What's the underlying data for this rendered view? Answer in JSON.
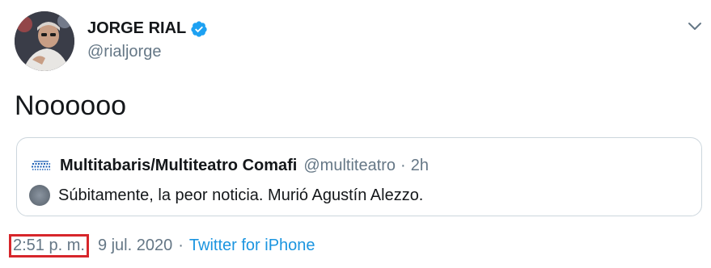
{
  "tweet": {
    "author": {
      "display_name": "JORGE RIAL",
      "handle": "@rialjorge",
      "verified": true
    },
    "text": "Noooooo",
    "quoted": {
      "name": "Multitabaris/Multiteatro Comafi",
      "handle": "@multiteatro",
      "separator": "·",
      "time": "2h",
      "text": "Súbitamente, la peor noticia. Murió Agustín Alezzo."
    },
    "meta": {
      "time": "2:51 p. m.",
      "date": "9 jul. 2020",
      "separator1": "·",
      "source": "Twitter for iPhone"
    }
  },
  "icons": {
    "verified": "verified-badge-icon",
    "menu": "chevron-down-icon",
    "quoted_avatar": "multiteatro-logo-icon",
    "media": "media-thumbnail-icon"
  },
  "colors": {
    "verified_blue": "#1da1f2",
    "link_blue": "#1b95e0",
    "secondary_text": "#657786",
    "highlight_red": "#d7262b"
  }
}
